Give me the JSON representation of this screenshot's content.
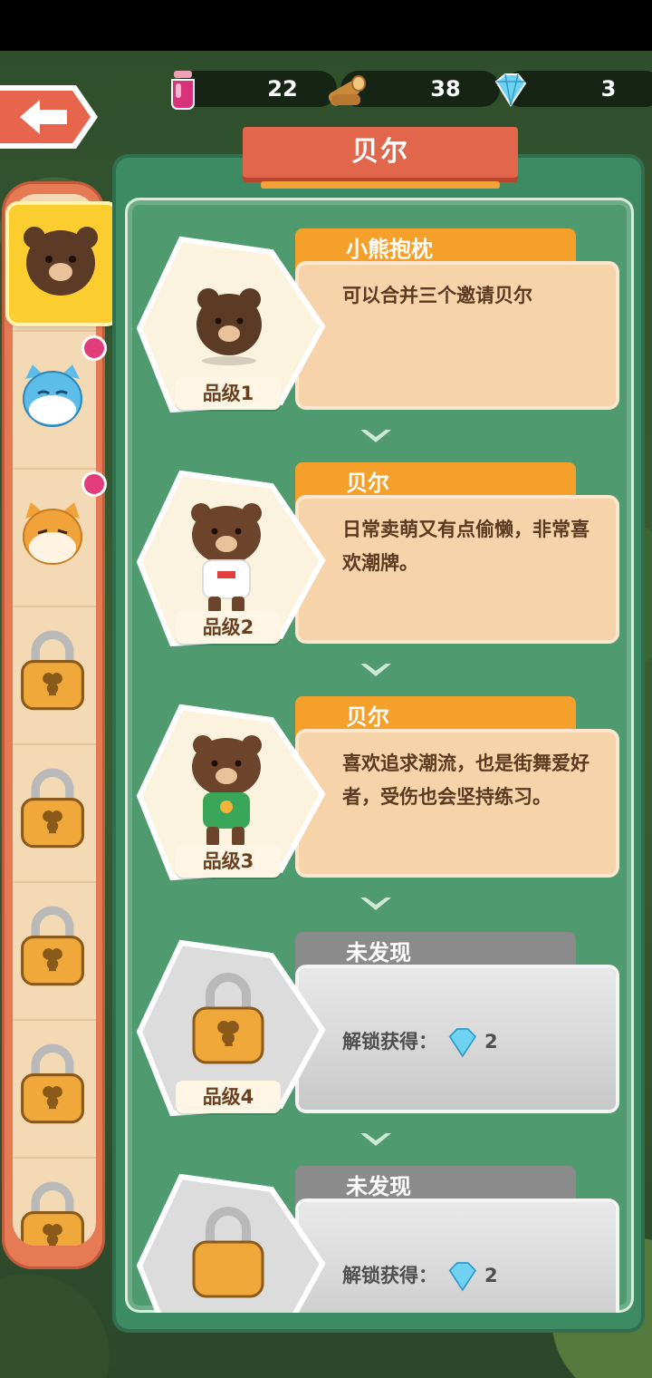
{
  "resources": [
    {
      "name": "potion",
      "value": "22"
    },
    {
      "name": "wood",
      "value": "38"
    },
    {
      "name": "gem",
      "value": "3"
    }
  ],
  "title": "贝尔",
  "cards": [
    {
      "tag": "小熊抱枕",
      "desc": "可以合并三个邀请贝尔",
      "grade": "品级1",
      "locked": false
    },
    {
      "tag": "贝尔",
      "desc": "日常卖萌又有点偷懒，非常喜欢潮牌。",
      "grade": "品级2",
      "locked": false
    },
    {
      "tag": "贝尔",
      "desc": "喜欢追求潮流，也是街舞爱好者，受伤也会坚持练习。",
      "grade": "品级3",
      "locked": false
    },
    {
      "tag": "未发现",
      "unlock_label": "解锁获得：",
      "unlock_amount": "2",
      "grade": "品级4",
      "locked": true
    },
    {
      "tag": "未发现",
      "unlock_label": "解锁获得：",
      "unlock_amount": "2",
      "locked": true
    }
  ],
  "side_list": [
    "bear-head-icon",
    "blue-cat-icon",
    "shiba-dog-icon",
    "padlock-icon",
    "padlock-icon",
    "padlock-icon",
    "padlock-icon",
    "padlock-icon"
  ],
  "colors": {
    "panel": "#3c8b63",
    "tag": "#f4a02a",
    "banner": "#e2664c",
    "desc_bg": "#f6d3a9"
  }
}
